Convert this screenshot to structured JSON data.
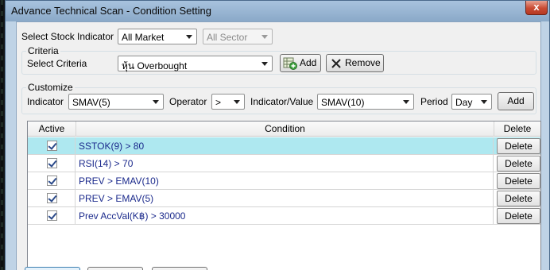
{
  "window": {
    "title": "Advance Technical Scan - Condition Setting",
    "close_label": "x"
  },
  "stock": {
    "label": "Select Stock Indicator",
    "market_value": "All Market",
    "sector_value": "All Sector"
  },
  "criteria": {
    "group_title": "Criteria",
    "label": "Select Criteria",
    "value": "หุ้น Overbought",
    "add_label": "Add",
    "remove_label": "Remove"
  },
  "customize": {
    "group_title": "Customize",
    "indicator_label": "Indicator",
    "indicator_value": "SMAV(5)",
    "operator_label": "Operator",
    "operator_value": ">",
    "value_label": "Indicator/Value",
    "value_value": "SMAV(10)",
    "period_label": "Period",
    "period_value": "Day",
    "add_label": "Add"
  },
  "grid": {
    "headers": {
      "active": "Active",
      "condition": "Condition",
      "delete": "Delete"
    },
    "rows": [
      {
        "active": true,
        "condition": "SSTOK(9) > 80",
        "delete": "Delete",
        "selected": true
      },
      {
        "active": true,
        "condition": "RSI(14) > 70",
        "delete": "Delete",
        "selected": false
      },
      {
        "active": true,
        "condition": "PREV > EMAV(10)",
        "delete": "Delete",
        "selected": false
      },
      {
        "active": true,
        "condition": "PREV > EMAV(5)",
        "delete": "Delete",
        "selected": false
      },
      {
        "active": true,
        "condition": "Prev AccVal(K฿) > 30000",
        "delete": "Delete",
        "selected": false
      }
    ]
  },
  "colors": {
    "selected_row": "#aee8f0",
    "condition_text": "#1b2a8c",
    "title_bar": "#a8c3de",
    "close_button": "#c94a32"
  }
}
